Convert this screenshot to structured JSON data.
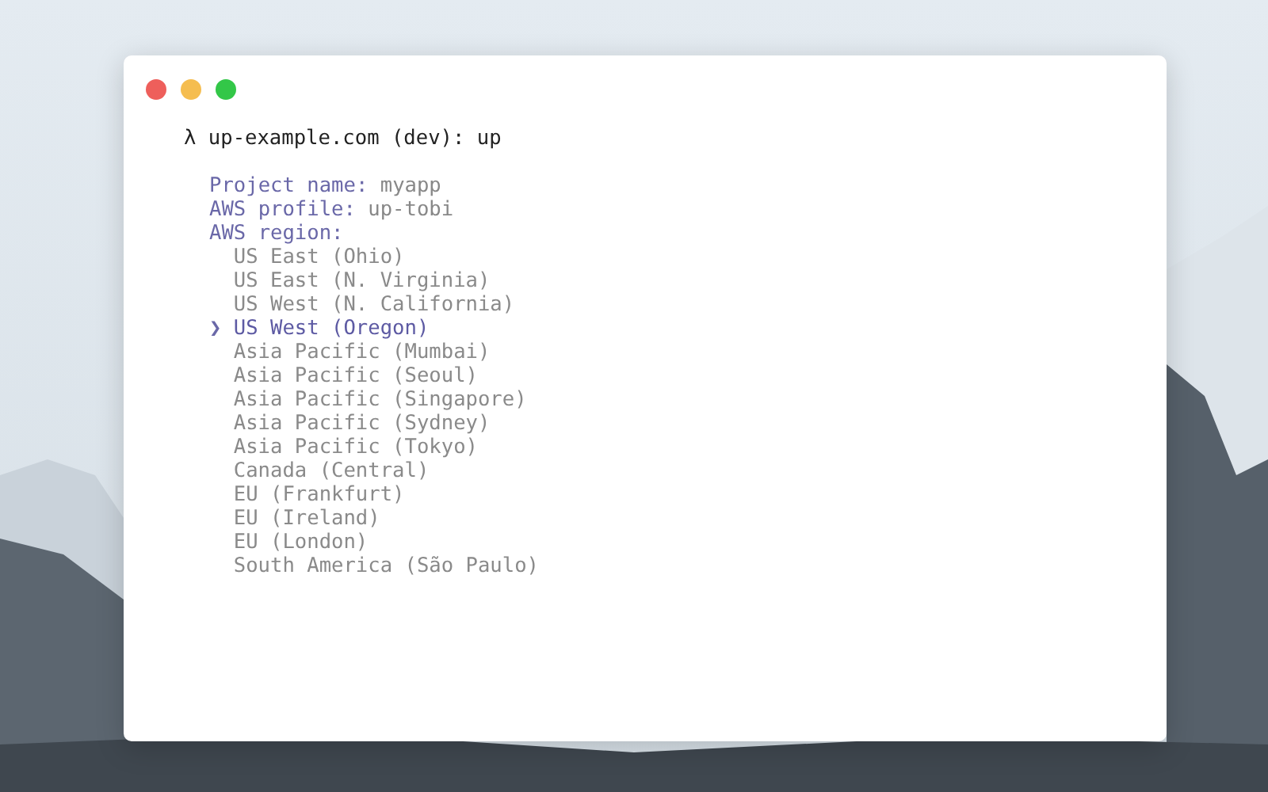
{
  "terminal": {
    "prompt": {
      "symbol": "λ",
      "command": "up-example.com (dev): up"
    },
    "fields": [
      {
        "label": "Project name:",
        "value": "myapp"
      },
      {
        "label": "AWS profile:",
        "value": "up-tobi"
      },
      {
        "label": "AWS region:"
      }
    ],
    "pointer": "❯",
    "options": [
      {
        "label": "US East (Ohio)",
        "selected": false
      },
      {
        "label": "US East (N. Virginia)",
        "selected": false
      },
      {
        "label": "US West (N. California)",
        "selected": false
      },
      {
        "label": "US West (Oregon)",
        "selected": true
      },
      {
        "label": "Asia Pacific (Mumbai)",
        "selected": false
      },
      {
        "label": "Asia Pacific (Seoul)",
        "selected": false
      },
      {
        "label": "Asia Pacific (Singapore)",
        "selected": false
      },
      {
        "label": "Asia Pacific (Sydney)",
        "selected": false
      },
      {
        "label": "Asia Pacific (Tokyo)",
        "selected": false
      },
      {
        "label": "Canada (Central)",
        "selected": false
      },
      {
        "label": "EU (Frankfurt)",
        "selected": false
      },
      {
        "label": "EU (Ireland)",
        "selected": false
      },
      {
        "label": "EU (London)",
        "selected": false
      },
      {
        "label": "South America (São Paulo)",
        "selected": false
      }
    ]
  }
}
